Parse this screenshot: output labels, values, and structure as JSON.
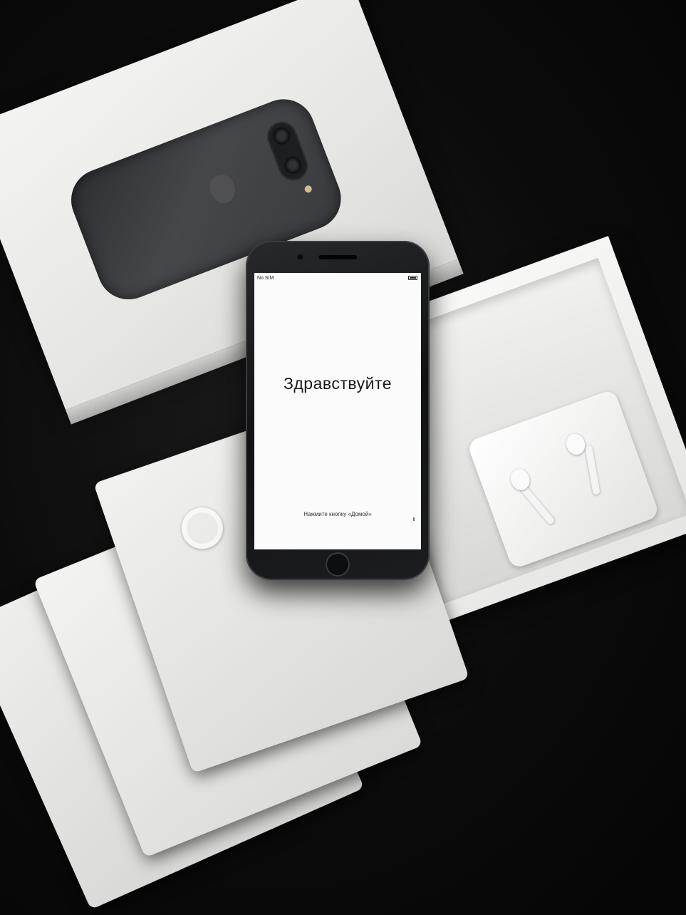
{
  "phone": {
    "status_carrier": "No SIM",
    "greeting": "Здравствуйте",
    "home_hint": "Нажмите кнопку «Домой»"
  },
  "icons": [
    "battery-icon",
    "camera-icon",
    "apple-logo-icon",
    "home-button-icon"
  ]
}
